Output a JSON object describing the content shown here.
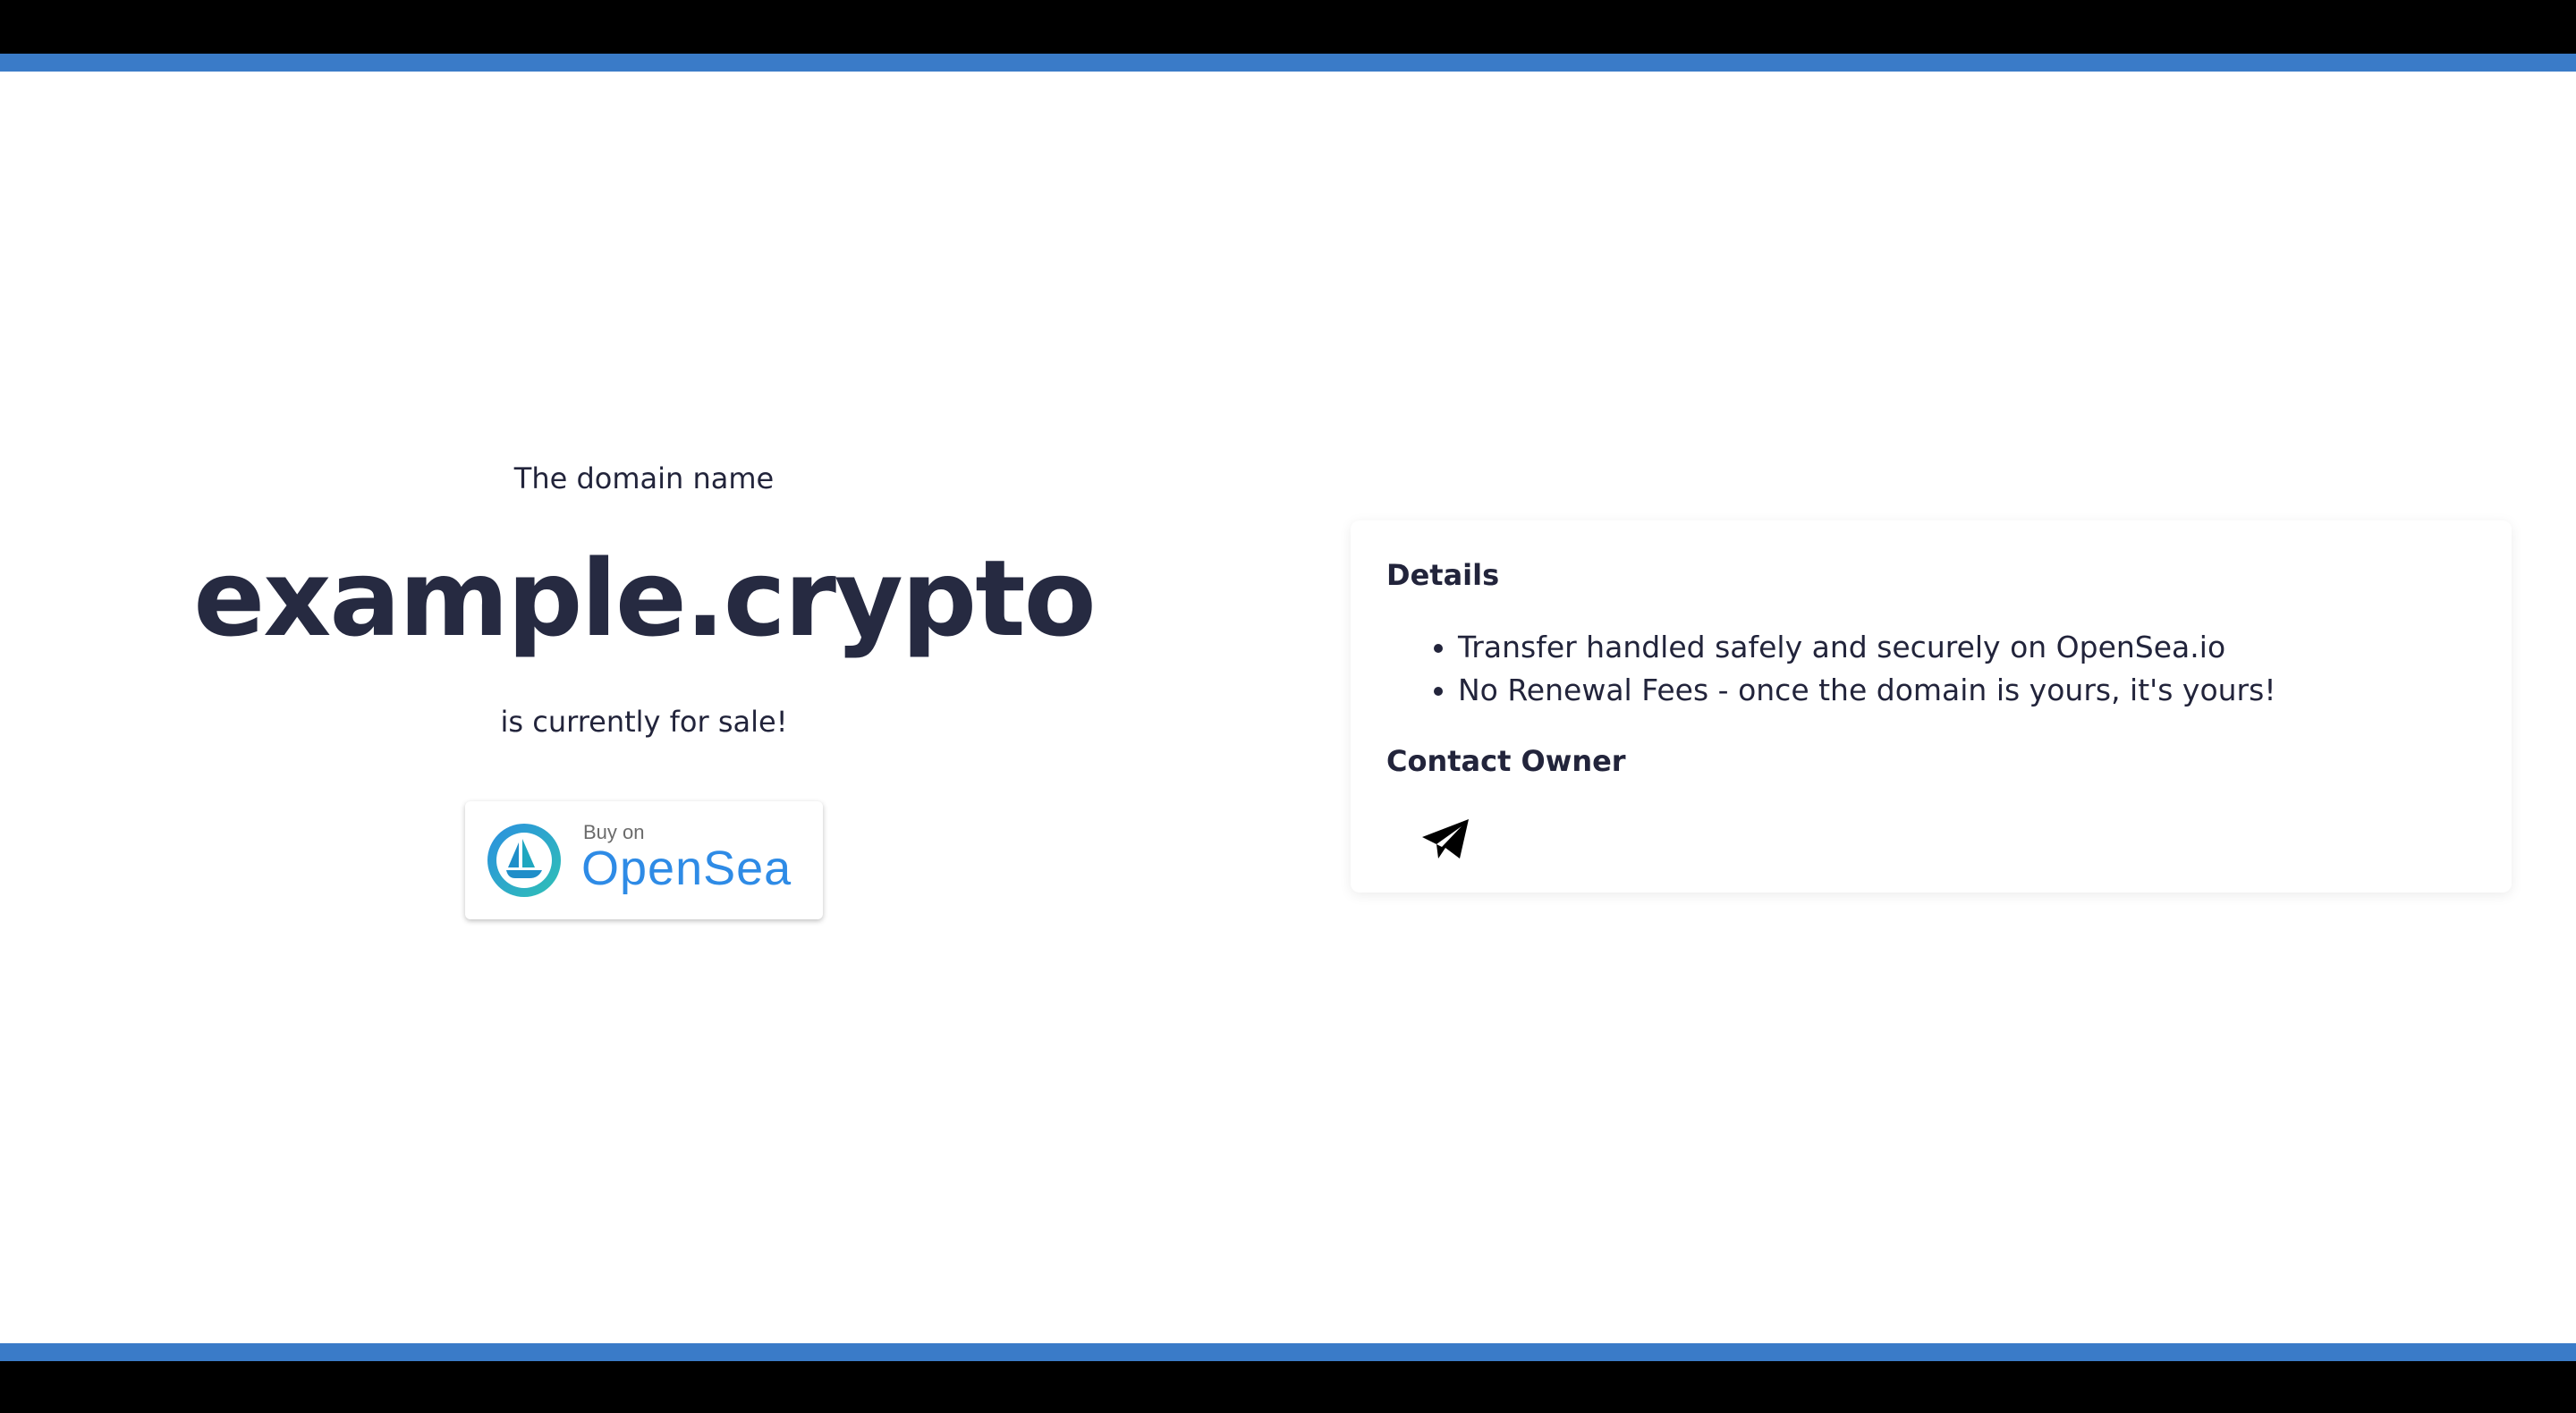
{
  "colors": {
    "accent": "#3a7bc8",
    "frame": "#000000",
    "text": "#22243b",
    "opensea_blue": "#2e8be6"
  },
  "hero": {
    "intro": "The domain name",
    "domain": "example.crypto",
    "status": "is currently for sale!"
  },
  "opensea_button": {
    "prefix": "Buy on",
    "brand": "OpenSea",
    "icon": "opensea-logo-icon"
  },
  "details_card": {
    "title": "Details",
    "items": [
      "Transfer handled safely and securely on OpenSea.io",
      "No Renewal Fees - once the domain is yours, it's yours!"
    ],
    "contact_title": "Contact Owner",
    "contact_icon": "telegram-icon"
  }
}
